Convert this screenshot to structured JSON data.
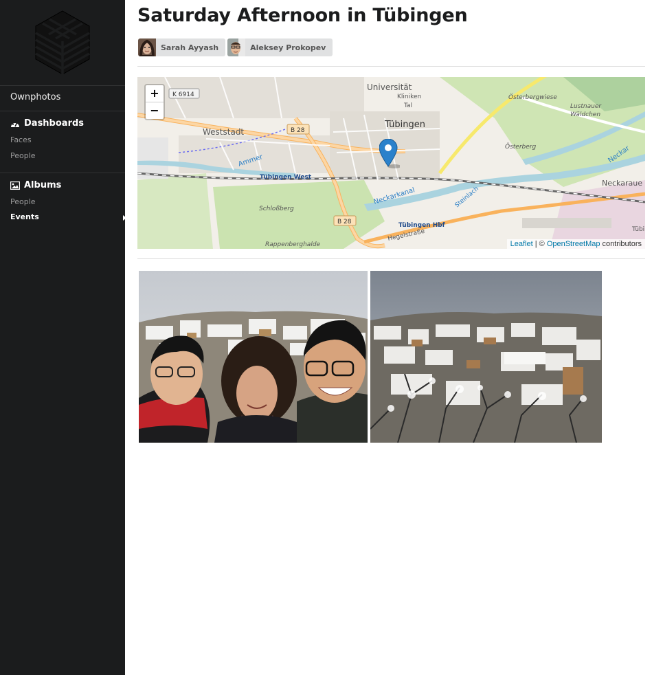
{
  "sidebar": {
    "logo": "ownphotos-logo",
    "brand": "Ownphotos",
    "dashboards": {
      "label": "Dashboards",
      "icon": "dashboard-icon",
      "items": [
        "Faces",
        "People"
      ]
    },
    "albums": {
      "label": "Albums",
      "icon": "image-icon",
      "items": [
        "People",
        "Events"
      ],
      "active": "Events"
    }
  },
  "main": {
    "title": "Saturday Afternoon in Tübingen",
    "people": [
      {
        "name": "Sarah Ayyash",
        "avatar": "avatar-sarah"
      },
      {
        "name": "Aleksey Prokopev",
        "avatar": "avatar-aleksey"
      }
    ],
    "map": {
      "zoom_in": "+",
      "zoom_out": "−",
      "attribution": {
        "leaflet": "Leaflet",
        "separator": " | © ",
        "osm": "OpenStreetMap",
        "suffix": " contributors"
      },
      "labels": {
        "universitat": "Universität",
        "kliniken": "Kliniken",
        "tal": "Tal",
        "tubingen": "Tübingen",
        "weststadt": "Weststadt",
        "osterbergwiese": "Österbergwiese",
        "lustnauer": "Lustnauer",
        "waldchen": "Wäldchen",
        "osterberg": "Österberg",
        "ammer": "Ammer",
        "tubingen_west": "Tübingen West",
        "neckarkanal": "Neckarkanal",
        "steinlach": "Steinlach",
        "neckar": "Neckar",
        "neckaraue": "Neckaraue",
        "schlossberg": "Schloßberg",
        "tubingen_hbf": "Tübingen Hbf",
        "hegelstrasse": "Hegelstraße",
        "rappenberghalde": "Rappenberghalde",
        "k6914": "K 6914",
        "b28a": "B 28",
        "b28b": "B 28",
        "tubi": "Tübi"
      },
      "colors": {
        "marker": "#2a81cb",
        "road": "#f9b25c",
        "water": "#aad3df",
        "park": "#c8e6a8"
      }
    },
    "photos": [
      {
        "name": "photo-selfie-snow",
        "description": ""
      },
      {
        "name": "photo-snowy-town",
        "description": ""
      }
    ]
  }
}
